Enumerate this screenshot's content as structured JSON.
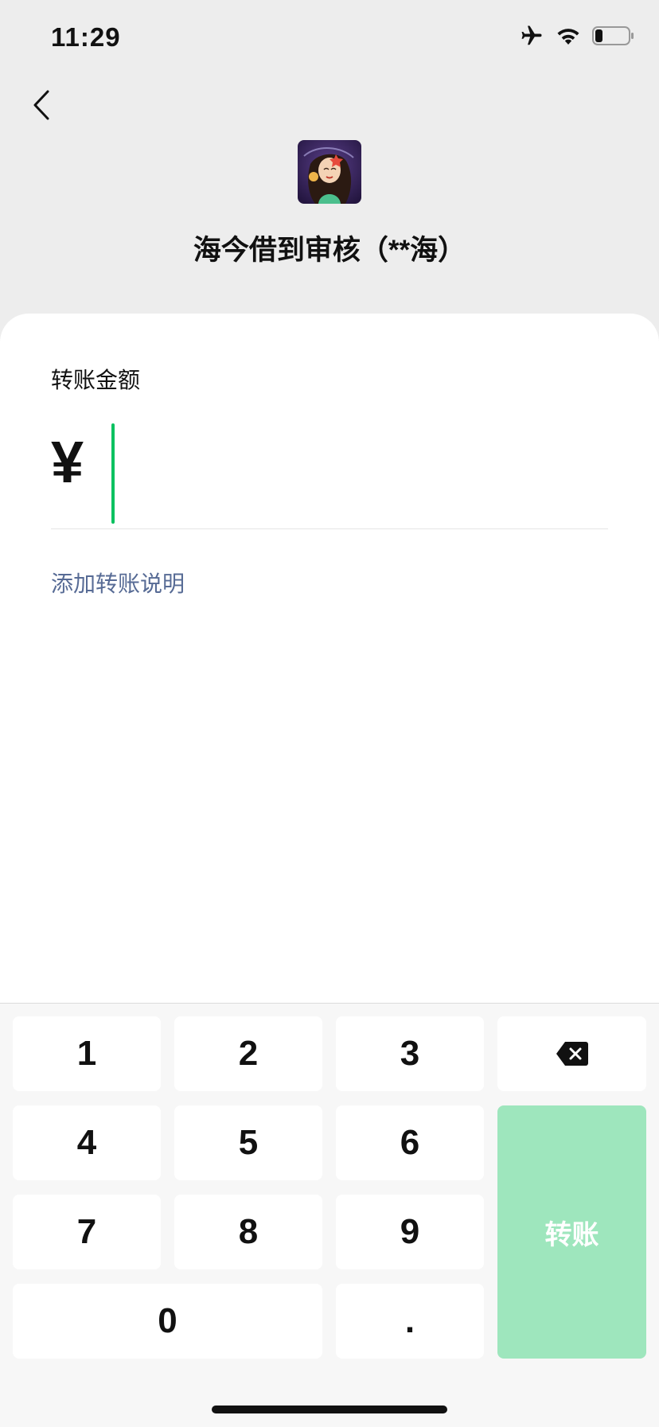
{
  "status_bar": {
    "time": "11:29"
  },
  "payee": {
    "name": "海今借到审核（**海）"
  },
  "transfer": {
    "amount_label": "转账金额",
    "currency_symbol": "¥",
    "amount_value": "",
    "add_note_label": "添加转账说明"
  },
  "keypad": {
    "digits": [
      "1",
      "2",
      "3",
      "4",
      "5",
      "6",
      "7",
      "8",
      "9",
      "0",
      "."
    ],
    "transfer_label": "转账"
  },
  "colors": {
    "caret": "#07c160",
    "transfer_button": "#9ee6bd",
    "link": "#576b95",
    "background": "#ededed"
  },
  "icons": {
    "back": "chevron-left-icon",
    "airplane": "airplane-icon",
    "wifi": "wifi-icon",
    "battery": "battery-icon",
    "delete": "backspace-icon"
  }
}
